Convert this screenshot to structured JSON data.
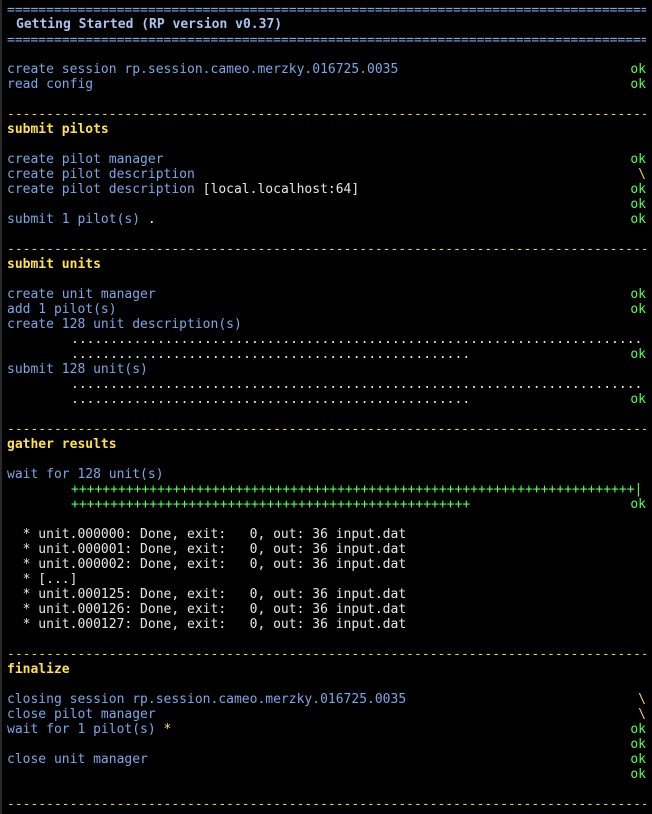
{
  "rules": {
    "double": "=======================================================================================================",
    "dashed": "-------------------------------------------------------------------------------------------------------"
  },
  "title": "Getting Started (RP version v0.37)",
  "header_block": {
    "create_session_label": "create session",
    "session_id": "rp.session.cameo.merzky.016725.0035",
    "read_config": "read config",
    "status_ok": "ok"
  },
  "submit_pilots": {
    "heading": "submit pilots",
    "create_pilot_manager": "create pilot manager",
    "create_pilot_description_1": "create pilot description",
    "create_pilot_description_2": "create pilot description",
    "pilot_resource": "[local.localhost:64]",
    "submit_pilots_label": "submit 1 pilot(s)",
    "submit_pilots_dot": ".",
    "spinner": "\\",
    "ok": "ok"
  },
  "submit_units": {
    "heading": "submit units",
    "create_unit_manager": "create unit manager",
    "add_pilot": "add 1 pilot(s)",
    "create_unit_descriptions": "create 128 unit description(s)",
    "dots_full": ".........................................................................",
    "dots_partial": "...................................................",
    "submit_units_label": "submit 128 unit(s)",
    "ok": "ok"
  },
  "gather_results": {
    "heading": "gather results",
    "wait_units": "wait for 128 unit(s)",
    "plus_full": "++++++++++++++++++++++++++++++++++++++++++++++++++++++++++++++++++++++++|",
    "plus_partial": "+++++++++++++++++++++++++++++++++++++++++++++++++++",
    "ok": "ok",
    "units": [
      "  * unit.000000: Done, exit:   0, out: 36 input.dat",
      "  * unit.000001: Done, exit:   0, out: 36 input.dat",
      "  * unit.000002: Done, exit:   0, out: 36 input.dat",
      "  * [...]",
      "  * unit.000125: Done, exit:   0, out: 36 input.dat",
      "  * unit.000126: Done, exit:   0, out: 36 input.dat",
      "  * unit.000127: Done, exit:   0, out: 36 input.dat"
    ]
  },
  "finalize": {
    "heading": "finalize",
    "closing_session": "closing session rp.session.cameo.merzky.016725.0035",
    "close_pilot_manager": "close pilot manager",
    "wait_pilot": "wait for 1 pilot(s)",
    "wait_star": "*",
    "close_unit_manager": "close unit manager",
    "spinner": "\\",
    "ok": "ok"
  },
  "colors": {
    "background": "#000000",
    "log_blue": "#7aa7e6",
    "section_yellow": "#ffe14d",
    "ok_green": "#55ff55"
  }
}
